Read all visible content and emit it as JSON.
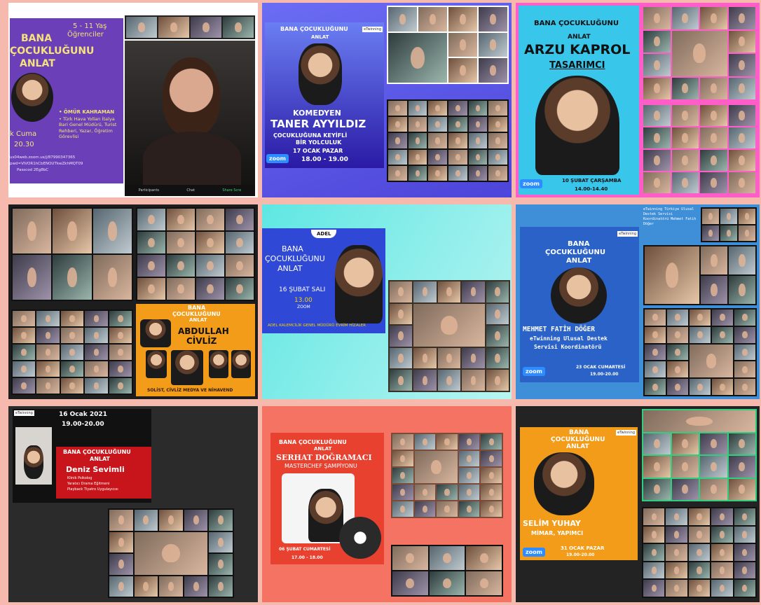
{
  "panels": {
    "p1": {
      "age": "5 - 11 Yaş",
      "audience": "Öğrenciler",
      "title_l1": "BANA",
      "title_l2": "ÇOCUKLUĞUNU",
      "title_l3": "ANLAT",
      "guest": "• ÖMÜR KAHRAMAN",
      "role": "• Türk Hava Yolları İtalya Bari Genel Müdürü, Turist Rehberi, Yazar, Öğretim Görevlisi",
      "day": "k Cuma",
      "time": "20.30",
      "url": "us04web.zoom.us/j/87990347365",
      "pwd": "pwd=VlVOR1hCbENOUTkwZkhMQT09",
      "passcode": "Passcod 2Eg8bC",
      "toolbar": [
        "Participants",
        "Chat",
        "Share Scre"
      ]
    },
    "p2": {
      "title": "BANA ÇOCUKLUĞUNU",
      "sub": "ANLAT",
      "badge": "eTwinning",
      "kind": "KOMEDYEN",
      "name": "TANER AYYILDIZ",
      "tag1": "ÇOCUKLUĞUNA KEYİFLİ",
      "tag2": "BİR YOLCULUK",
      "date": "17 OCAK PAZAR",
      "time": "18.00 - 19.00",
      "zoom": "zoom"
    },
    "p3": {
      "title": "BANA ÇOCUKLUĞUNU",
      "sub": "ANLAT",
      "name": "ARZU KAPROL",
      "role": "TASARIMCI",
      "date": "10 ŞUBAT ÇARŞAMBA",
      "time": "14.00-14.40",
      "zoom": "zoom"
    },
    "p4": {
      "title": "BANA",
      "title2": "ÇOCUKLUĞUNU",
      "sub": "ANLAT",
      "name1": "ABDULLAH",
      "name2": "CİVLİZ",
      "footer": "SOLİST, CİVLİZ MEDYA VE NİHAVEND"
    },
    "p5": {
      "logo": "ADEL",
      "title1": "BANA",
      "title2": "ÇOCUKLUĞUNU",
      "title3": "ANLAT",
      "date": "16 ŞUBAT SALI",
      "time": "13.00",
      "zoom": "ZOOM",
      "footer": "ADEL KALEMCİLİK GENEL MÜDÜRÜ EVRİM HİZALER"
    },
    "p6": {
      "note": "eTwinning Türkiye Ulusal Destek Servisi Koordinatörü Mehmet Fatih Döğer",
      "title": "BANA",
      "title2": "ÇOCUKLUĞUNU",
      "sub": "ANLAT",
      "badge": "eTwinning",
      "name": "MEHMET FATİH DÖĞER",
      "role1": "eTwinning Ulusal Destek",
      "role2": "Servisi Koordinatörü",
      "date": "23 OCAK CUMARTESİ",
      "time": "19.00-20.00",
      "zoom": "zoom"
    },
    "p7": {
      "badge": "eTwinning",
      "date": "16 Ocak 2021",
      "time": "19.00-20.00",
      "title": "BANA ÇOCUKLUĞUNU",
      "sub": "ANLAT",
      "name": "Deniz Sevimli",
      "r1": "Klinik Psikolog",
      "r2": "Yaratıcı Drama Eğitmeni",
      "r3": "Playback Tiyatro Uygulayıcısı"
    },
    "p8": {
      "title": "BANA ÇOCUKLUĞUNU",
      "sub": "ANLAT",
      "name": "SERHAT DOĞRAMACI",
      "role": "MASTERCHEF ŞAMPİYONU",
      "date": "06 ŞUBAT CUMARTESİ",
      "time": "17.00 - 18.00"
    },
    "p9": {
      "title": "BANA",
      "title2": "ÇOCUKLUĞUNU",
      "sub": "ANLAT",
      "badge": "eTwinning",
      "name": "SELİM YUHAY",
      "role": "MİMAR, YAPIMCI",
      "date": "31 OCAK PAZAR",
      "time": "19.00-20.00",
      "zoom": "zoom"
    }
  },
  "colors": {
    "background": "#f6b9ad",
    "purple": "#6a3fb8",
    "yellow": "#f5d400",
    "blue": "#2f49d6",
    "cyan": "#38c6ea",
    "orange": "#f39c1a",
    "red": "#c8141b",
    "coral": "#f57363"
  }
}
